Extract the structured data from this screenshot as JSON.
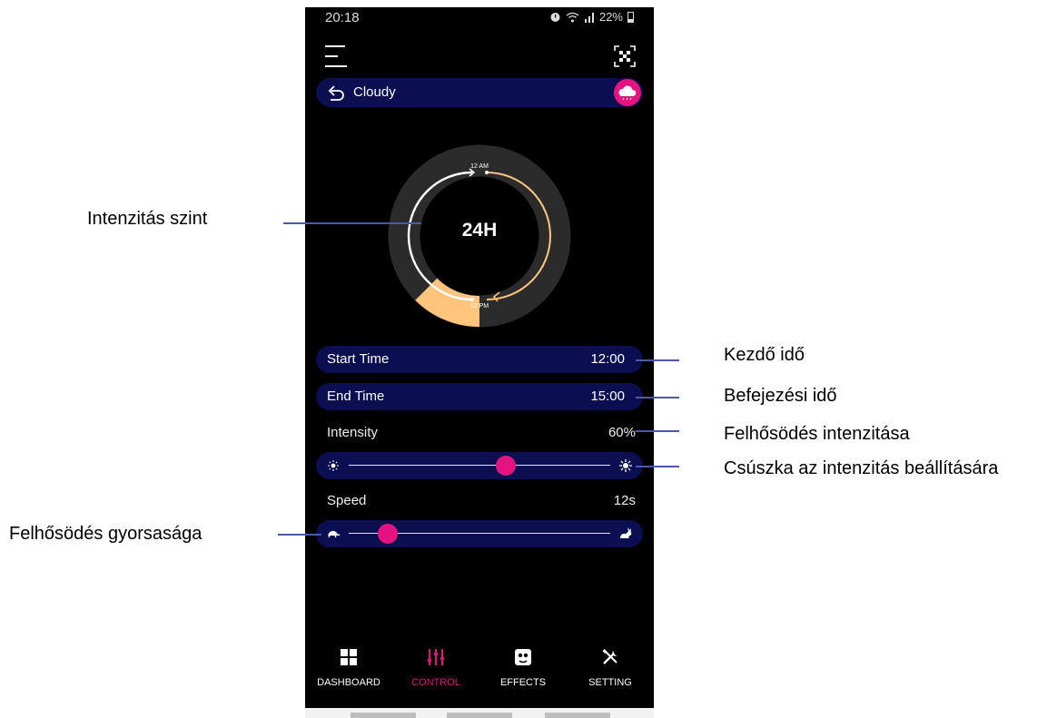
{
  "status_bar": {
    "time": "20:18",
    "battery": "22%"
  },
  "scene": {
    "name": "Cloudy"
  },
  "dial": {
    "label": "24H",
    "tick_top": "12 AM",
    "tick_bottom": "12 PM",
    "intensity_fraction": 0.125
  },
  "schedule": {
    "start_label": "Start Time",
    "start_value": "12:00",
    "end_label": "End Time",
    "end_value": "15:00"
  },
  "intensity": {
    "label": "Intensity",
    "value": "60%",
    "fraction": 0.6
  },
  "speed": {
    "label": "Speed",
    "value": "12s",
    "fraction": 0.15
  },
  "nav": {
    "items": [
      {
        "label": "DASHBOARD",
        "icon": "grid-icon"
      },
      {
        "label": "CONTROL",
        "icon": "sliders-icon",
        "active": true
      },
      {
        "label": "EFFECTS",
        "icon": "effects-icon"
      },
      {
        "label": "SETTING",
        "icon": "tools-icon"
      }
    ]
  },
  "annotations": {
    "intensity_level": "Intenzitás szint",
    "start_time": "Kezdő idő",
    "end_time": "Befejezési idő",
    "cloud_intensity": "Felhősödés intenzitása",
    "slider_note": "Csúszka az intenzitás beállítására",
    "cloud_speed": "Felhősödés gyorsasága"
  },
  "colors": {
    "accent": "#e5137f",
    "pill": "#0b0f52",
    "arc": "#ffc57d",
    "ring": "#2b2b2b",
    "annotation_line": "#4a5aa8"
  }
}
